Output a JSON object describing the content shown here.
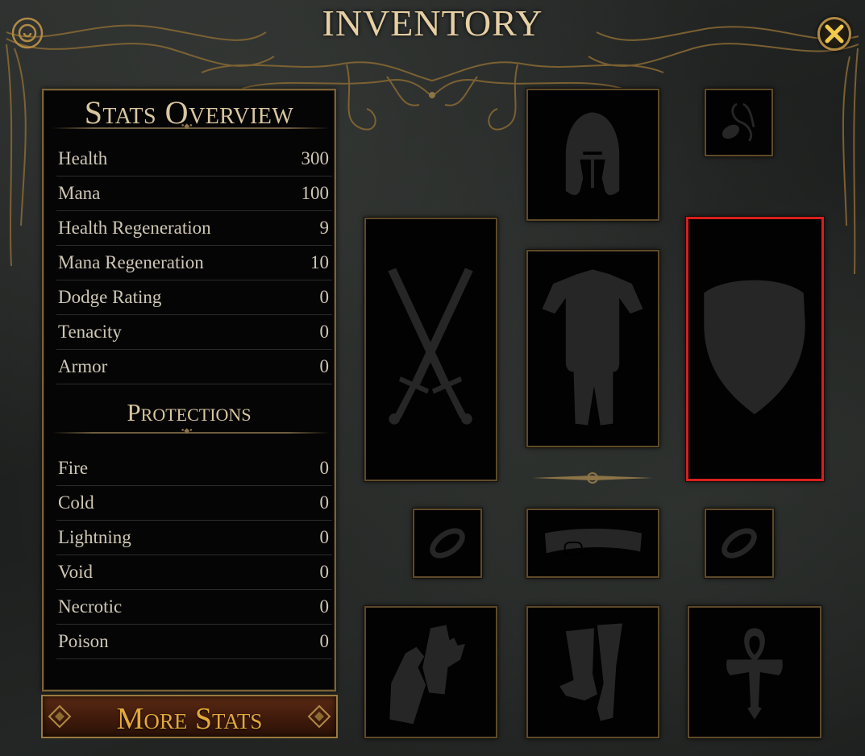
{
  "window": {
    "title": "INVENTORY",
    "close_icon": "close-x-icon"
  },
  "stats_overview": {
    "title": "Stats Overview",
    "stats": [
      {
        "label": "Health",
        "value": "300"
      },
      {
        "label": "Mana",
        "value": "100"
      },
      {
        "label": "Health Regeneration",
        "value": "9"
      },
      {
        "label": "Mana Regeneration",
        "value": "10"
      },
      {
        "label": "Dodge Rating",
        "value": "0"
      },
      {
        "label": "Tenacity",
        "value": "0"
      },
      {
        "label": "Armor",
        "value": "0"
      }
    ],
    "protections_title": "Protections",
    "protections": [
      {
        "label": "Fire",
        "value": "0"
      },
      {
        "label": "Cold",
        "value": "0"
      },
      {
        "label": "Lightning",
        "value": "0"
      },
      {
        "label": "Void",
        "value": "0"
      },
      {
        "label": "Necrotic",
        "value": "0"
      },
      {
        "label": "Poison",
        "value": "0"
      }
    ]
  },
  "more_stats_button": {
    "label": "More Stats"
  },
  "equipment_slots": [
    {
      "slot": "helmet",
      "icon": "helmet-icon"
    },
    {
      "slot": "amulet",
      "icon": "amulet-icon"
    },
    {
      "slot": "weapon",
      "icon": "crossed-swords-icon"
    },
    {
      "slot": "body-armor",
      "icon": "body-armor-icon"
    },
    {
      "slot": "offhand",
      "icon": "shield-icon",
      "highlighted": true
    },
    {
      "slot": "left-ring",
      "icon": "ring-icon"
    },
    {
      "slot": "belt",
      "icon": "belt-icon"
    },
    {
      "slot": "right-ring",
      "icon": "ring-icon"
    },
    {
      "slot": "gloves",
      "icon": "gloves-icon"
    },
    {
      "slot": "boots",
      "icon": "boots-icon"
    },
    {
      "slot": "relic",
      "icon": "ankh-relic-icon"
    }
  ],
  "colors": {
    "accent_gold": "#e6cfa4",
    "button_text": "#e3a93a",
    "highlight": "#d81e1e",
    "silhouette": "#262626"
  }
}
